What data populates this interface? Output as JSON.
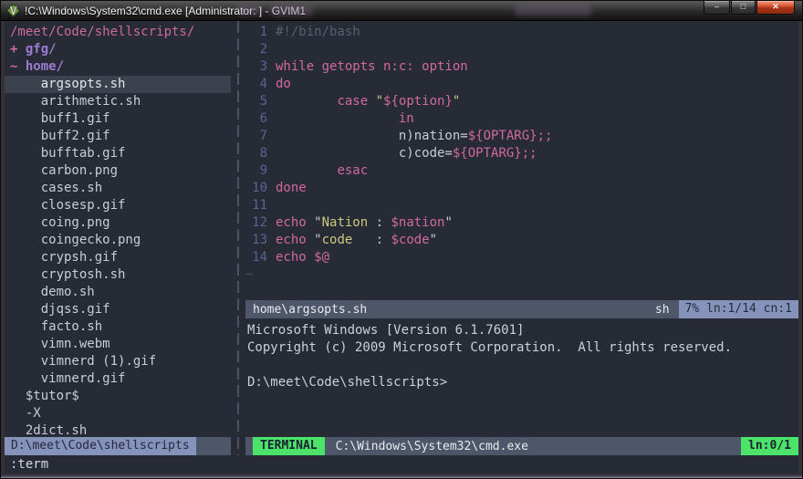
{
  "window": {
    "title": "!C:\\Windows\\System32\\cmd.exe [Administrator:  ] - GVIM1",
    "controls": {
      "minimize": "–",
      "maximize": "□",
      "close": "✕"
    }
  },
  "colors": {
    "background": "#262b35",
    "pink": "#d2699e",
    "purple": "#9d7bd4",
    "yellow": "#cbca7d",
    "status_blue": "#8592ba",
    "status_green": "#4ce36a",
    "statusbar": "#4e5669",
    "selection": "#3b414d"
  },
  "tree": {
    "rows": [
      {
        "type": "root",
        "text": "/meet/Code/shellscripts/"
      },
      {
        "type": "dir",
        "marker": "+",
        "text": "gfg/"
      },
      {
        "type": "dir",
        "marker": "~",
        "text": "home/"
      },
      {
        "type": "file",
        "pad": 4,
        "text": "argsopts.sh",
        "selected": true
      },
      {
        "type": "file",
        "pad": 4,
        "text": "arithmetic.sh"
      },
      {
        "type": "file",
        "pad": 4,
        "text": "buff1.gif"
      },
      {
        "type": "file",
        "pad": 4,
        "text": "buff2.gif"
      },
      {
        "type": "file",
        "pad": 4,
        "text": "bufftab.gif"
      },
      {
        "type": "file",
        "pad": 4,
        "text": "carbon.png"
      },
      {
        "type": "file",
        "pad": 4,
        "text": "cases.sh"
      },
      {
        "type": "file",
        "pad": 4,
        "text": "closesp.gif"
      },
      {
        "type": "file",
        "pad": 4,
        "text": "coing.png"
      },
      {
        "type": "file",
        "pad": 4,
        "text": "coingecko.png"
      },
      {
        "type": "file",
        "pad": 4,
        "text": "crypsh.gif"
      },
      {
        "type": "file",
        "pad": 4,
        "text": "cryptosh.sh"
      },
      {
        "type": "file",
        "pad": 4,
        "text": "demo.sh"
      },
      {
        "type": "file",
        "pad": 4,
        "text": "djqss.gif"
      },
      {
        "type": "file",
        "pad": 4,
        "text": "facto.sh"
      },
      {
        "type": "file",
        "pad": 4,
        "text": "vimn.webm"
      },
      {
        "type": "file",
        "pad": 4,
        "text": "vimnerd (1).gif"
      },
      {
        "type": "file",
        "pad": 4,
        "text": "vimnerd.gif"
      },
      {
        "type": "file",
        "pad": 2,
        "text": "$tutor$"
      },
      {
        "type": "file",
        "pad": 2,
        "text": "-X"
      },
      {
        "type": "file",
        "pad": 2,
        "text": "2dict.sh"
      }
    ],
    "status_path": "D:\\meet\\Code\\shellscripts"
  },
  "editor": {
    "lines": [
      {
        "n": "1",
        "toks": [
          [
            "c",
            "#!/bin/bash"
          ]
        ]
      },
      {
        "n": "2",
        "toks": []
      },
      {
        "n": "3",
        "toks": [
          [
            "k",
            "while getopts n:c: option"
          ]
        ]
      },
      {
        "n": "4",
        "toks": [
          [
            "k",
            "do"
          ]
        ]
      },
      {
        "n": "5",
        "toks": [
          [
            "f",
            "        "
          ],
          [
            "k",
            "case "
          ],
          [
            "s",
            "\""
          ],
          [
            "k",
            "${option}"
          ],
          [
            "s",
            "\""
          ]
        ]
      },
      {
        "n": "6",
        "toks": [
          [
            "f",
            "                "
          ],
          [
            "k",
            "in"
          ]
        ]
      },
      {
        "n": "7",
        "toks": [
          [
            "f",
            "                n)nation="
          ],
          [
            "k",
            "${OPTARG};;"
          ]
        ]
      },
      {
        "n": "8",
        "toks": [
          [
            "f",
            "                c)code="
          ],
          [
            "k",
            "${OPTARG};;"
          ]
        ]
      },
      {
        "n": "9",
        "toks": [
          [
            "f",
            "        "
          ],
          [
            "k",
            "esac"
          ]
        ]
      },
      {
        "n": "10",
        "toks": [
          [
            "k",
            "done"
          ]
        ]
      },
      {
        "n": "11",
        "toks": []
      },
      {
        "n": "12",
        "toks": [
          [
            "k",
            "echo "
          ],
          [
            "f",
            "\""
          ],
          [
            "s",
            "Nation"
          ],
          [
            "f",
            " : "
          ],
          [
            "k",
            "$nation"
          ],
          [
            "f",
            "\""
          ]
        ]
      },
      {
        "n": "13",
        "toks": [
          [
            "k",
            "echo "
          ],
          [
            "f",
            "\""
          ],
          [
            "s",
            "code"
          ],
          [
            "f",
            "   : "
          ],
          [
            "k",
            "$code"
          ],
          [
            "f",
            "\""
          ]
        ]
      },
      {
        "n": "14",
        "toks": [
          [
            "k",
            "echo $@"
          ]
        ]
      },
      {
        "tilde": "~"
      }
    ],
    "status": {
      "file": "home\\argsopts.sh",
      "filetype": "sh",
      "position": "7% ln:1/14 cn:1"
    }
  },
  "terminal": {
    "lines": [
      "Microsoft Windows [Version 6.1.7601]",
      "Copyright (c) 2009 Microsoft Corporation.  All rights reserved.",
      "",
      "D:\\meet\\Code\\shellscripts>"
    ],
    "status": {
      "mode": "TERMINAL",
      "title": "C:\\Windows\\System32\\cmd.exe",
      "position": "ln:0/1"
    }
  },
  "cmdline": ":term"
}
